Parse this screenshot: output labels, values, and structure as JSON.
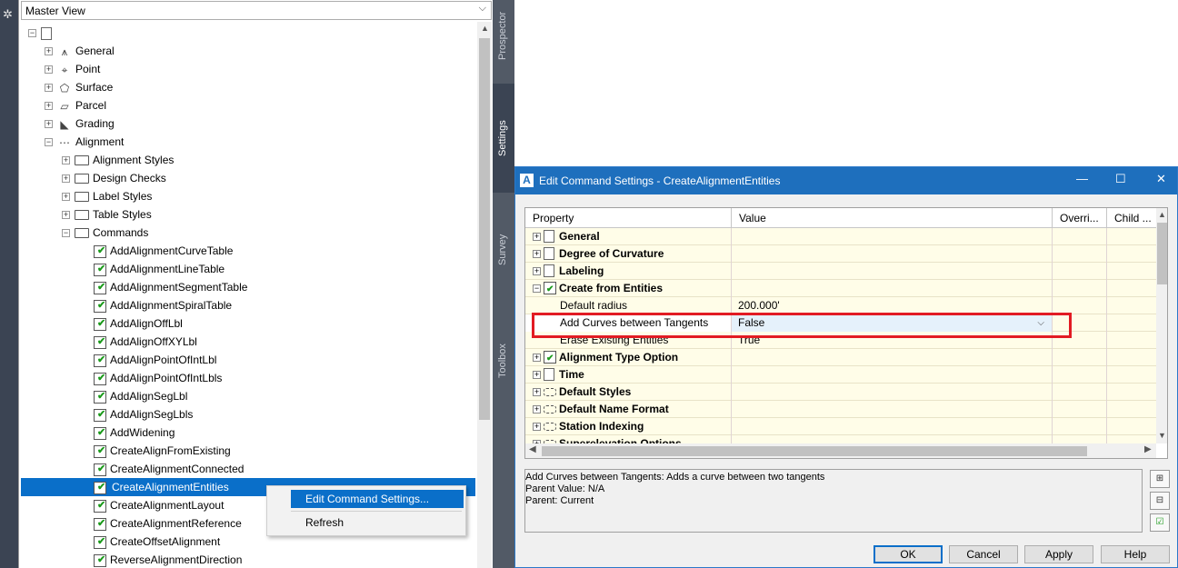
{
  "toolspace": {
    "view_selector": "Master View",
    "tree": [
      {
        "label": "General",
        "level": 1,
        "icon": "general-category-icon",
        "exp": "+"
      },
      {
        "label": "Point",
        "level": 1,
        "icon": "point-icon",
        "exp": "+"
      },
      {
        "label": "Surface",
        "level": 1,
        "icon": "surface-icon",
        "exp": "+"
      },
      {
        "label": "Parcel",
        "level": 1,
        "icon": "parcel-icon",
        "exp": "+"
      },
      {
        "label": "Grading",
        "level": 1,
        "icon": "grading-icon",
        "exp": "+"
      },
      {
        "label": "Alignment",
        "level": 1,
        "icon": "alignment-icon",
        "exp": "−"
      },
      {
        "label": "Alignment Styles",
        "level": 2,
        "icon": "folder-icon",
        "exp": "+"
      },
      {
        "label": "Design Checks",
        "level": 2,
        "icon": "folder-icon",
        "exp": "+"
      },
      {
        "label": "Label Styles",
        "level": 2,
        "icon": "folder-icon",
        "exp": "+"
      },
      {
        "label": "Table Styles",
        "level": 2,
        "icon": "folder-icon",
        "exp": "+"
      },
      {
        "label": "Commands",
        "level": 2,
        "icon": "folder-open-icon",
        "exp": "−"
      },
      {
        "label": "AddAlignmentCurveTable",
        "level": 3,
        "icon": "command-icon"
      },
      {
        "label": "AddAlignmentLineTable",
        "level": 3,
        "icon": "command-icon"
      },
      {
        "label": "AddAlignmentSegmentTable",
        "level": 3,
        "icon": "command-icon"
      },
      {
        "label": "AddAlignmentSpiralTable",
        "level": 3,
        "icon": "command-icon"
      },
      {
        "label": "AddAlignOffLbl",
        "level": 3,
        "icon": "command-icon"
      },
      {
        "label": "AddAlignOffXYLbl",
        "level": 3,
        "icon": "command-icon"
      },
      {
        "label": "AddAlignPointOfIntLbl",
        "level": 3,
        "icon": "command-icon"
      },
      {
        "label": "AddAlignPointOfIntLbls",
        "level": 3,
        "icon": "command-icon"
      },
      {
        "label": "AddAlignSegLbl",
        "level": 3,
        "icon": "command-icon"
      },
      {
        "label": "AddAlignSegLbls",
        "level": 3,
        "icon": "command-icon"
      },
      {
        "label": "AddWidening",
        "level": 3,
        "icon": "command-icon"
      },
      {
        "label": "CreateAlignFromExisting",
        "level": 3,
        "icon": "command-icon"
      },
      {
        "label": "CreateAlignmentConnected",
        "level": 3,
        "icon": "command-icon"
      },
      {
        "label": "CreateAlignmentEntities",
        "level": 3,
        "icon": "command-icon",
        "selected": true
      },
      {
        "label": "CreateAlignmentLayout",
        "level": 3,
        "icon": "command-icon"
      },
      {
        "label": "CreateAlignmentReference",
        "level": 3,
        "icon": "command-icon"
      },
      {
        "label": "CreateOffsetAlignment",
        "level": 3,
        "icon": "command-icon"
      },
      {
        "label": "ReverseAlignmentDirection",
        "level": 3,
        "icon": "command-icon"
      }
    ]
  },
  "context_menu": {
    "edit_label": "Edit Command Settings...",
    "refresh_label": "Refresh"
  },
  "vtabs": {
    "prospector": "Prospector",
    "settings": "Settings",
    "survey": "Survey",
    "toolbox": "Toolbox"
  },
  "dialog": {
    "title": "Edit Command Settings - CreateAlignmentEntities",
    "headers": {
      "property": "Property",
      "value": "Value",
      "override": "Overri...",
      "child": "Child ..."
    },
    "rows": [
      {
        "kind": "cat",
        "label": "General",
        "icon": "doc",
        "exp": "+"
      },
      {
        "kind": "cat",
        "label": "Degree of Curvature",
        "icon": "doc",
        "exp": "+"
      },
      {
        "kind": "cat",
        "label": "Labeling",
        "icon": "doc",
        "exp": "+"
      },
      {
        "kind": "cat",
        "label": "Create from Entities",
        "icon": "cmd",
        "exp": "−"
      },
      {
        "kind": "sub",
        "label": "Default radius",
        "value": "200.000'"
      },
      {
        "kind": "sub",
        "label": "Add Curves between Tangents",
        "value": "False",
        "selected": true
      },
      {
        "kind": "sub",
        "label": "Erase Existing Entities",
        "value": "True"
      },
      {
        "kind": "cat",
        "label": "Alignment Type Option",
        "icon": "cmd",
        "exp": "+"
      },
      {
        "kind": "cat",
        "label": "Time",
        "icon": "doc",
        "exp": "+"
      },
      {
        "kind": "cat",
        "label": "Default Styles",
        "icon": "dash",
        "exp": "+"
      },
      {
        "kind": "cat",
        "label": "Default Name Format",
        "icon": "dash",
        "exp": "+"
      },
      {
        "kind": "cat",
        "label": "Station Indexing",
        "icon": "dash",
        "exp": "+"
      },
      {
        "kind": "cat",
        "label": "Superelevation Options",
        "icon": "dash",
        "exp": "+"
      }
    ],
    "description": {
      "line1": "Add Curves between Tangents: Adds a curve between two tangents",
      "line2": "Parent Value: N/A",
      "line3": "Parent: Current"
    },
    "buttons": {
      "ok": "OK",
      "cancel": "Cancel",
      "apply": "Apply",
      "help": "Help"
    }
  },
  "colors": {
    "title_bar": "#1e6fbd",
    "selection": "#0a6fc9",
    "highlight_box": "#e21b23",
    "grid_body": "#fffde8"
  }
}
